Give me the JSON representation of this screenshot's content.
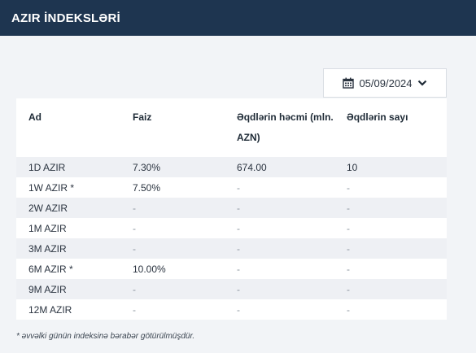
{
  "header": {
    "title": "AZIR İNDEKSLƏRİ"
  },
  "date_picker": {
    "value": "05/09/2024"
  },
  "table": {
    "columns": [
      "Ad",
      "Faiz",
      "Əqdlərin həcmi (mln. AZN)",
      "Əqdlərin sayı"
    ],
    "rows": [
      {
        "name": "1D AZIR",
        "rate": "7.30%",
        "volume": "674.00",
        "count": "10"
      },
      {
        "name": "1W AZIR *",
        "rate": "7.50%",
        "volume": "-",
        "count": "-"
      },
      {
        "name": "2W AZIR",
        "rate": "-",
        "volume": "-",
        "count": "-"
      },
      {
        "name": "1M AZIR",
        "rate": "-",
        "volume": "-",
        "count": "-"
      },
      {
        "name": "3M AZIR",
        "rate": "-",
        "volume": "-",
        "count": "-"
      },
      {
        "name": "6M AZIR *",
        "rate": "10.00%",
        "volume": "-",
        "count": "-"
      },
      {
        "name": "9M AZIR",
        "rate": "-",
        "volume": "-",
        "count": "-"
      },
      {
        "name": "12M AZIR",
        "rate": "-",
        "volume": "-",
        "count": "-"
      }
    ]
  },
  "footnote": "* əvvəlki günün indeksinə bərabər götürülmüşdür.",
  "colors": {
    "header_bg": "#1e3550",
    "row_shade": "#eef0f4",
    "page_bg": "#f2f4f7"
  }
}
